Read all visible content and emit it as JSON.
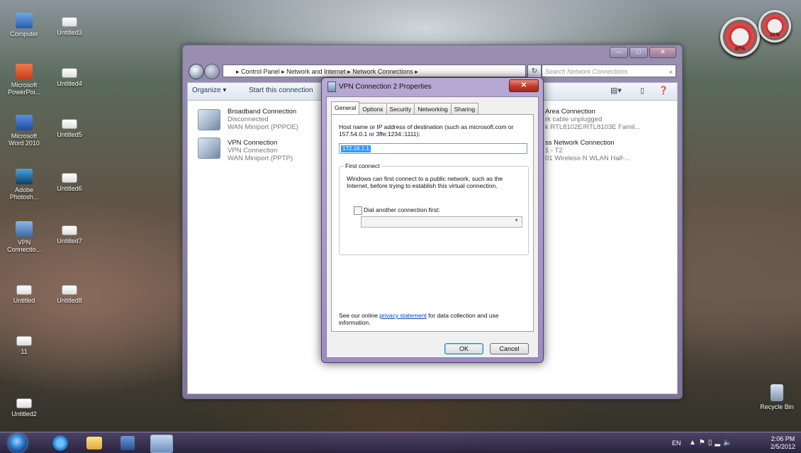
{
  "desktop": {
    "icons": [
      {
        "label": "Computer",
        "kind": "computer"
      },
      {
        "label": "Untitled3",
        "kind": "file"
      },
      {
        "label": "Microsoft PowerPoi...",
        "kind": "ppt"
      },
      {
        "label": "Untitled4",
        "kind": "file"
      },
      {
        "label": "Microsoft Word 2010",
        "kind": "word"
      },
      {
        "label": "Untitled5",
        "kind": "file"
      },
      {
        "label": "Adobe Photosh...",
        "kind": "ps"
      },
      {
        "label": "Untitled6",
        "kind": "file"
      },
      {
        "label": "VPN Connectio...",
        "kind": "vpn"
      },
      {
        "label": "Untitled7",
        "kind": "file"
      },
      {
        "label": "Untitled",
        "kind": "file"
      },
      {
        "label": "Untitled8",
        "kind": "file"
      },
      {
        "label": "11",
        "kind": "file"
      },
      {
        "label": "Untitled2",
        "kind": "file"
      },
      {
        "label": "Recycle Bin",
        "kind": "bin"
      }
    ],
    "gadgets": [
      {
        "label": "67%"
      },
      {
        "label": "31%"
      }
    ]
  },
  "explorer": {
    "window_controls": {
      "minimize": "—",
      "maximize": "□",
      "close": "✕"
    },
    "breadcrumbs": [
      "Control Panel",
      "Network and Internet",
      "Network Connections"
    ],
    "search_placeholder": "Search Network Connections",
    "toolbar": {
      "organize": "Organize ▾",
      "start_connection": "Start this connection"
    },
    "connections_left": [
      {
        "name": "Broadband Connection",
        "status": "Disconnected",
        "device": "WAN Miniport (PPPOE)"
      },
      {
        "name": "VPN Connection",
        "status": "VPN Connection",
        "device": "WAN Miniport (PPTP)"
      }
    ],
    "connections_right": [
      {
        "name": "Area Connection",
        "status": "rk cable unplugged",
        "device": "k RTL8102E/RTL8103E Famil..."
      },
      {
        "name": "ss Network Connection",
        "status": "1 - T2",
        "device": "01 Wireless-N WLAN Half-..."
      }
    ]
  },
  "dialog": {
    "title": "VPN Connection 2 Properties",
    "close": "✕",
    "tabs": [
      "General",
      "Options",
      "Security",
      "Networking",
      "Sharing"
    ],
    "host_hint": "Host name or IP address of destination (such as microsoft.com or 157.54.0.1 or 3ffe:1234::1111):",
    "host_value": "172.16.1.1",
    "first_connect": {
      "label": "First connect",
      "text": "Windows can first connect to a public network, such as the Internet, before trying to establish this virtual connection.",
      "checkbox_label": "Dial another connection first:"
    },
    "privacy_prefix": "See our online ",
    "privacy_link": "privacy statement",
    "privacy_suffix": " for data collection and use information.",
    "ok": "OK",
    "cancel": "Cancel"
  },
  "taskbar": {
    "lang": "EN",
    "time": "2:06 PM",
    "date": "2/5/2012"
  }
}
